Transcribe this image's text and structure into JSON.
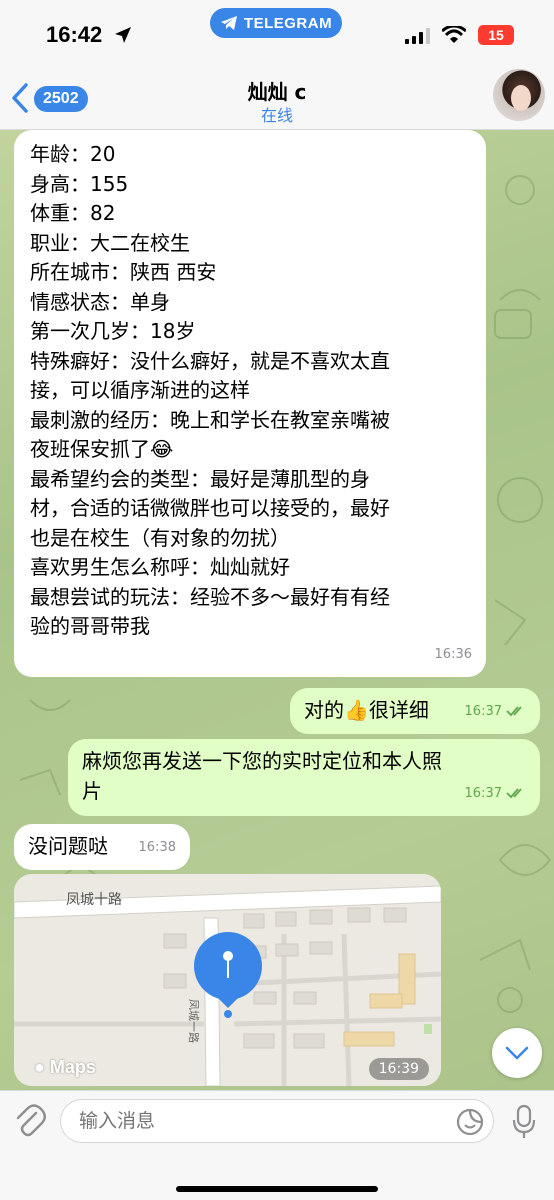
{
  "status_bar": {
    "time": "16:42",
    "app_pill": "TELEGRAM",
    "battery": "15"
  },
  "header": {
    "back_count": "2502",
    "title": "灿灿 c",
    "status": "在线"
  },
  "messages": {
    "profile": {
      "lines": [
        "年龄：20",
        "身高：155",
        "体重：82",
        "职业：大二在校生",
        "所在城市：陕西 西安",
        "情感状态：单身",
        "第一次几岁：18岁",
        "特殊癖好：没什么癖好，就是不喜欢太直",
        "接，可以循序渐进的这样",
        "最刺激的经历：晚上和学长在教室亲嘴被",
        "夜班保安抓了😂",
        "最希望约会的类型：最好是薄肌型的身",
        "材，合适的话微微胖也可以接受的，最好",
        "也是在校生（有对象的勿扰）",
        "喜欢男生怎么称呼：灿灿就好",
        "最想尝试的玩法：经验不多～最好有有经",
        "验的哥哥带我"
      ],
      "time": "16:36"
    },
    "reply1": {
      "text": "对的👍很详细",
      "time": "16:37"
    },
    "reply2": {
      "text": "麻烦您再发送一下您的实时定位和本人照片",
      "line1": "麻烦您再发送一下您的实时定位和本人照",
      "line2": "片",
      "time": "16:37"
    },
    "ok": {
      "text": "没问题哒",
      "time": "16:38"
    },
    "location": {
      "street_label": "凤城十路",
      "side_street_label": "凤城一路",
      "provider": "Maps",
      "time": "16:39"
    }
  },
  "composer": {
    "placeholder": "输入消息"
  },
  "colors": {
    "accent": "#3a86e8",
    "incoming_bubble": "#ffffff",
    "outgoing_bubble": "#e1fec6",
    "outgoing_meta": "#5fa84b",
    "battery": "#ff3b30"
  },
  "icons": {
    "back": "chevron-left-icon",
    "attach": "paperclip-icon",
    "sticker": "sticker-icon",
    "mic": "microphone-icon",
    "scroll": "chevron-down-icon",
    "location_pin": "map-pin-icon"
  }
}
